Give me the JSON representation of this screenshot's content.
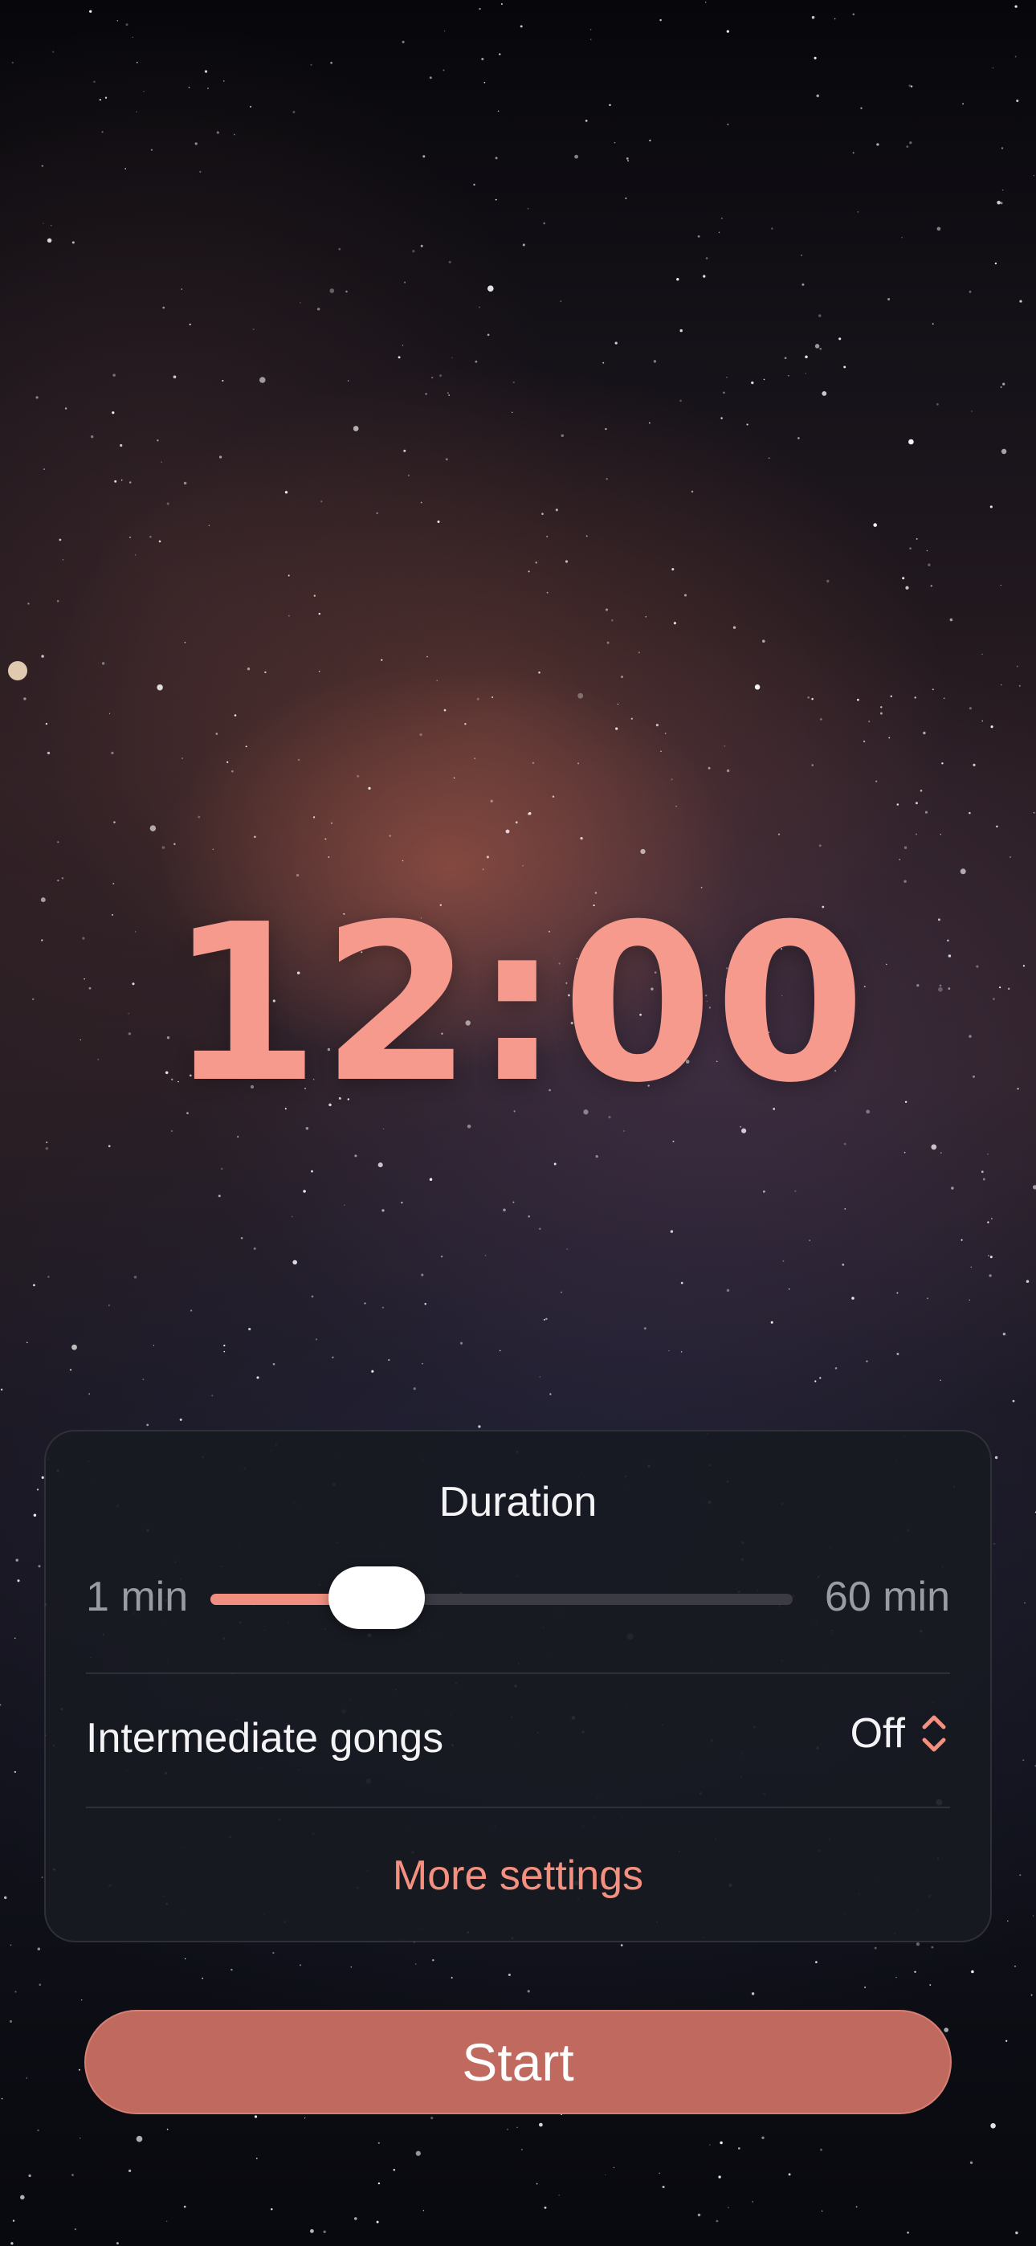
{
  "timer": {
    "display": "12:00"
  },
  "settings": {
    "duration_title": "Duration",
    "min_label": "1 min",
    "max_label": "60 min",
    "slider": {
      "min": 1,
      "max": 60,
      "value": 12
    },
    "gongs_label": "Intermediate gongs",
    "gongs_value": "Off",
    "more_settings_label": "More settings"
  },
  "start_button": {
    "label": "Start"
  },
  "colors": {
    "accent": "#f59a8c",
    "button": "#c0695f",
    "card": "#181a22"
  }
}
